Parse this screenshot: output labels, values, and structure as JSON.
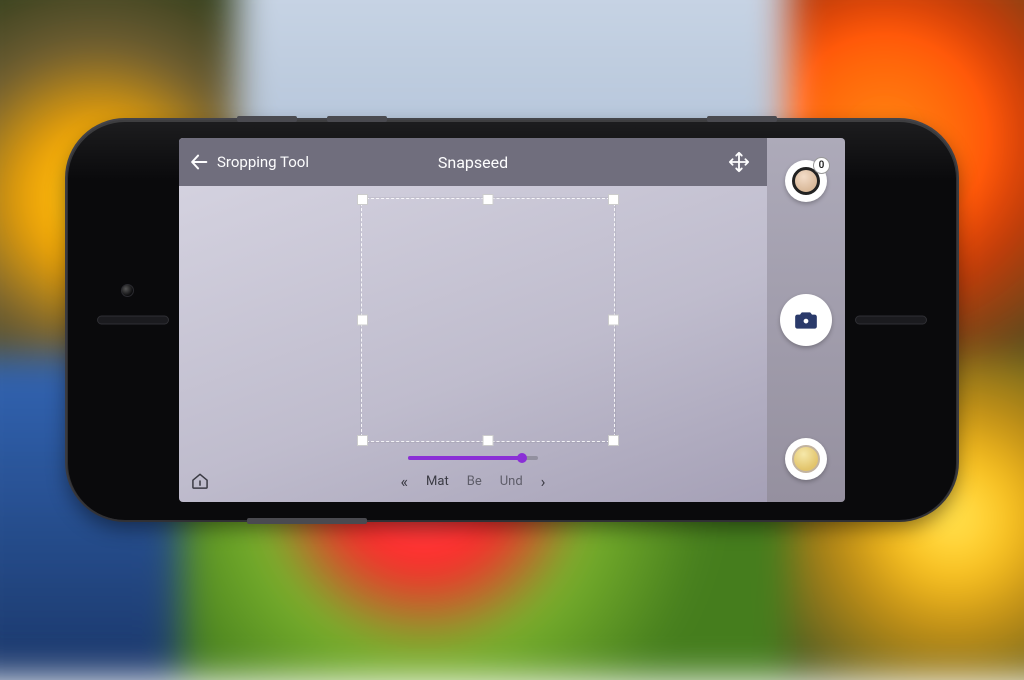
{
  "header": {
    "tool_title": "Sropping Tool",
    "app_title": "Snapseed"
  },
  "options": {
    "prev_glyph": "«",
    "next_glyph": "›",
    "items": [
      "Mat",
      "Be",
      "Und"
    ]
  },
  "slider": {
    "percent": 88
  },
  "rightrail": {
    "badge": "0"
  }
}
